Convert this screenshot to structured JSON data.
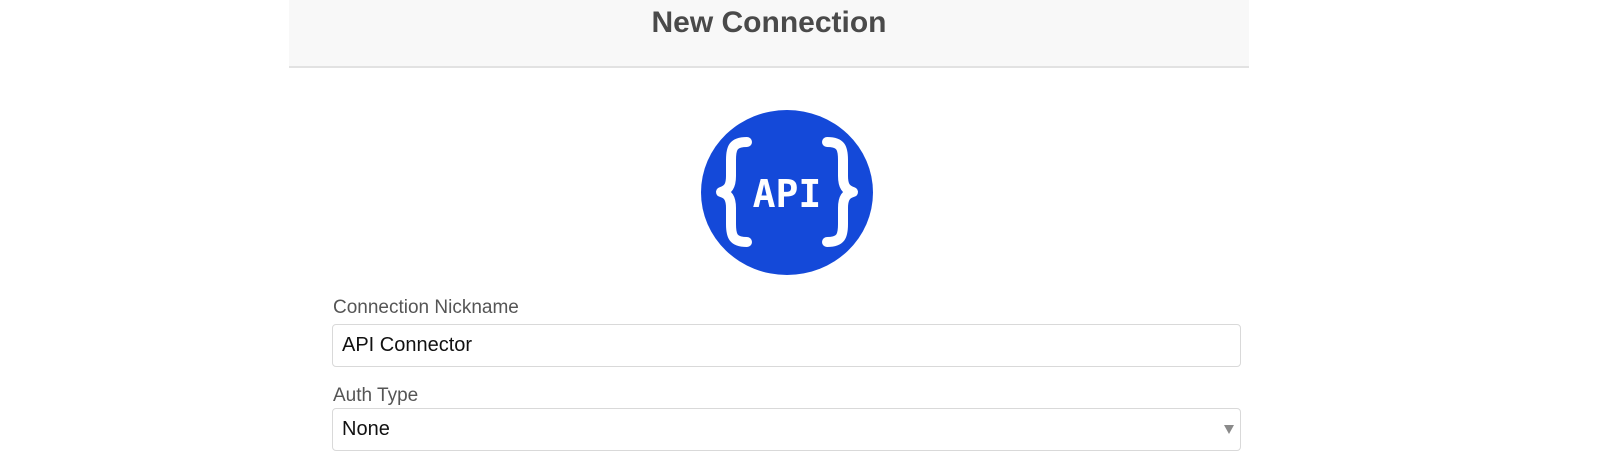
{
  "dialog": {
    "title": "New Connection"
  },
  "logo": {
    "icon": "api-logo-icon",
    "text": "API",
    "color": "#1449D9"
  },
  "form": {
    "nickname": {
      "label": "Connection Nickname",
      "value": "API Connector"
    },
    "auth_type": {
      "label": "Auth Type",
      "selected": "None"
    }
  }
}
